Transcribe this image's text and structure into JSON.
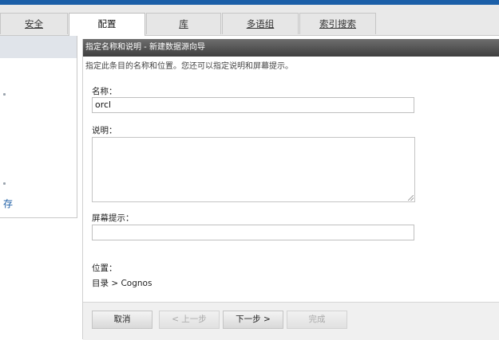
{
  "tabs": [
    {
      "label": "安全",
      "active": false
    },
    {
      "label": "配置",
      "active": true
    },
    {
      "label": "库",
      "active": false
    },
    {
      "label": "多语组",
      "active": false
    },
    {
      "label": "索引搜索",
      "active": false
    }
  ],
  "left_panel": {
    "link_text": "存"
  },
  "dialog": {
    "title": "指定名称和说明 - 新建数据源向导",
    "subtitle": "指定此条目的名称和位置。您还可以指定说明和屏幕提示。",
    "name_label": "名称：",
    "name_value": "orcl",
    "description_label": "说明：",
    "description_value": "",
    "screentip_label": "屏幕提示：",
    "screentip_value": "",
    "location_label": "位置：",
    "location_value": "目录 > Cognos"
  },
  "footer": {
    "cancel_label": "取消",
    "back_label": "< 上一步",
    "next_label": "下一步 >",
    "finish_label": "完成"
  },
  "colors": {
    "accent_top": "#1b5fa8",
    "title_bar": "#4a4a4a",
    "link": "#1f5fa6"
  }
}
